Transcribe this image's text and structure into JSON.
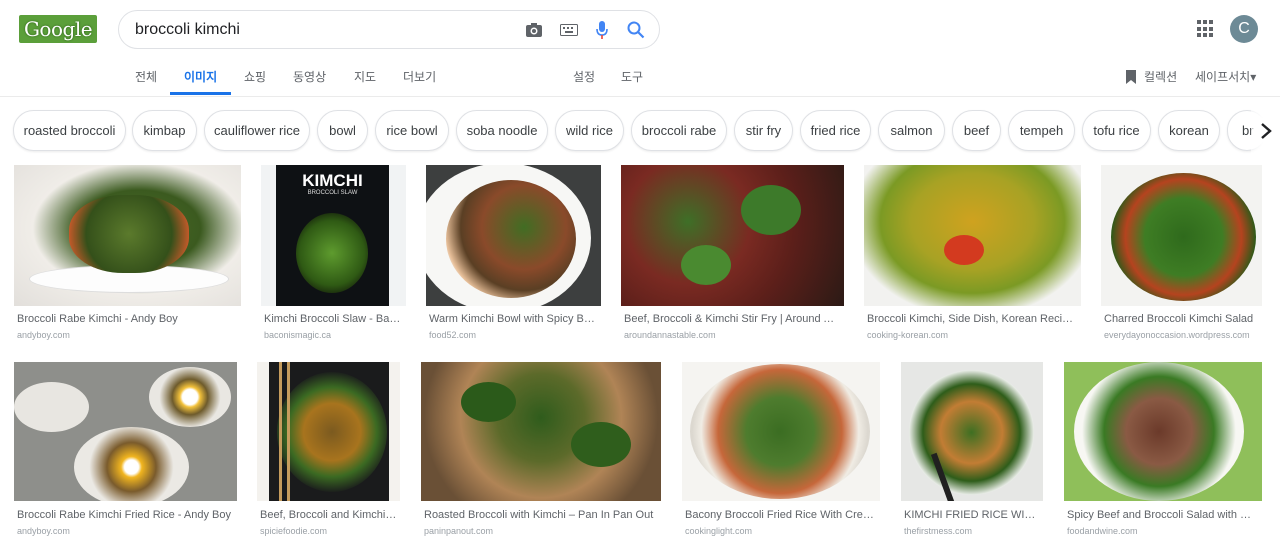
{
  "logo": {
    "text": "Google"
  },
  "search": {
    "query": "broccoli kimchi"
  },
  "icons": {
    "camera": "camera-icon",
    "keyboard": "keyboard-icon",
    "mic": "microphone-icon",
    "search": "search-icon",
    "apps": "apps-grid-icon",
    "collection": "bookmark-icon",
    "next": "chevron-right-icon"
  },
  "colors": {
    "accent": "#1a73e8",
    "mic_blue": "#4285f4",
    "mic_red": "#ea4335"
  },
  "avatar": {
    "initial": "C"
  },
  "tabs": [
    {
      "label": "전체"
    },
    {
      "label": "이미지",
      "active": true
    },
    {
      "label": "쇼핑"
    },
    {
      "label": "동영상"
    },
    {
      "label": "지도"
    },
    {
      "label": "더보기"
    },
    {
      "label": "설정"
    },
    {
      "label": "도구"
    }
  ],
  "header_right": {
    "collections_label": "컬렉션",
    "safesearch_label": "세이프서치▾"
  },
  "chips": [
    "roasted broccoli",
    "kimbap",
    "cauliflower rice",
    "bowl",
    "rice bowl",
    "soba noodle",
    "wild rice",
    "broccoli rabe",
    "stir fry",
    "fried rice",
    "salmon",
    "beef",
    "tempeh",
    "tofu rice",
    "korean",
    "br"
  ],
  "results": [
    {
      "title": "Broccoli Rabe Kimchi - Andy Boy",
      "source": "andyboy.com"
    },
    {
      "title": "Kimchi Broccoli Slaw - Baconismagic",
      "source": "baconismagic.ca",
      "cover_title": "KIMCHI",
      "cover_subtitle": "BROCCOLI SLAW"
    },
    {
      "title": "Warm Kimchi Bowl with Spicy Broccoli",
      "source": "food52.com"
    },
    {
      "title": "Beef, Broccoli & Kimchi Stir Fry | Around And Back",
      "source": "aroundannastable.com"
    },
    {
      "title": "Broccoli Kimchi, Side Dish, Korean Recipes",
      "source": "cooking-korean.com"
    },
    {
      "title": "Charred Broccoli Kimchi Salad",
      "source": "everydayonoccasion.wordpress.com"
    },
    {
      "title": "Broccoli Rabe Kimchi Fried Rice - Andy Boy",
      "source": "andyboy.com"
    },
    {
      "title": "Beef, Broccoli and Kimchi | Spicie Foodie",
      "source": "spiciefoodie.com"
    },
    {
      "title": "Roasted Broccoli with Kimchi – Pan In Pan Out",
      "source": "paninpanout.com"
    },
    {
      "title": "Bacony Broccoli Fried Rice With Creamy Kimchi",
      "source": "cookinglight.com"
    },
    {
      "title": "KIMCHI FRIED RICE WITH BROCCOLI",
      "source": "thefirstmess.com"
    },
    {
      "title": "Spicy Beef and Broccoli Salad with Kimchi",
      "source": "foodandwine.com"
    }
  ]
}
